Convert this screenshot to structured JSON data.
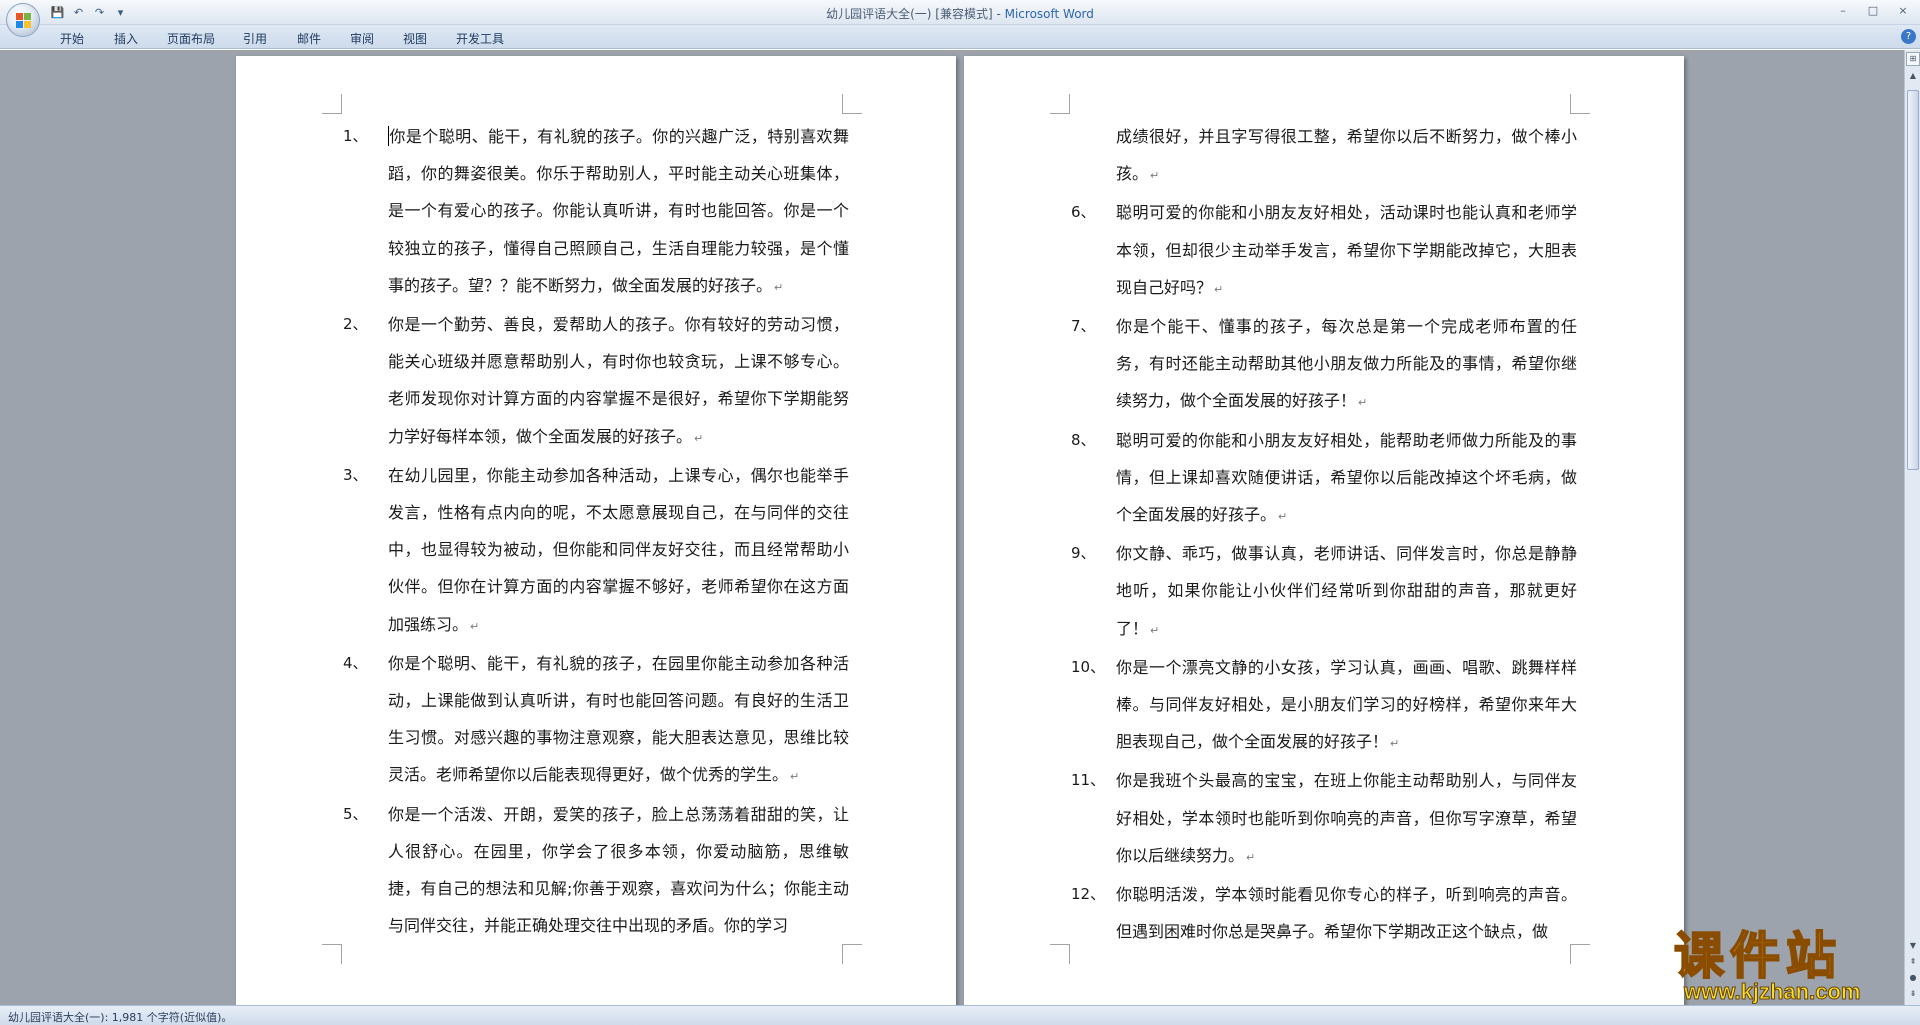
{
  "window": {
    "title": "幼儿园评语大全(一) [兼容模式] - ",
    "app_name": "Microsoft Word",
    "controls": [
      "–",
      "□",
      "×"
    ]
  },
  "quick_access": {
    "icons": [
      "save-icon",
      "undo-icon",
      "redo-icon",
      "customize-icon"
    ],
    "glyphs": [
      "💾",
      "↶",
      "↷",
      "▾"
    ]
  },
  "ribbon": {
    "tabs": [
      "开始",
      "插入",
      "页面布局",
      "引用",
      "邮件",
      "审阅",
      "视图",
      "开发工具"
    ]
  },
  "pages": [
    {
      "items": [
        {
          "num": "1、",
          "text": "你是个聪明、能干，有礼貌的孩子。你的兴趣广泛，特别喜欢舞蹈，你的舞姿很美。你乐于帮助别人，平时能主动关心班集体，是一个有爱心的孩子。你能认真听讲，有时也能回答。你是一个较独立的孩子，懂得自己照顾自己，生活自理能力较强，是个懂事的孩子。望？？能不断努力，做全面发展的好孩子。",
          "mark": true
        },
        {
          "num": "2、",
          "text": "你是一个勤劳、善良，爱帮助人的孩子。你有较好的劳动习惯，能关心班级并愿意帮助别人，有时你也较贪玩，上课不够专心。老师发现你对计算方面的内容掌握不是很好，希望你下学期能努力学好每样本领，做个全面发展的好孩子。",
          "mark": true
        },
        {
          "num": "3、",
          "text": "在幼儿园里，你能主动参加各种活动，上课专心，偶尔也能举手发言，性格有点内向的呢，不太愿意展现自己，在与同伴的交往中，也显得较为被动，但你能和同伴友好交往，而且经常帮助小伙伴。但你在计算方面的内容掌握不够好，老师希望你在这方面加强练习。",
          "mark": true
        },
        {
          "num": "4、",
          "text": "你是个聪明、能干，有礼貌的孩子，在园里你能主动参加各种活动，上课能做到认真听讲，有时也能回答问题。有良好的生活卫生习惯。对感兴趣的事物注意观察，能大胆表达意见，思维比较灵活。老师希望你以后能表现得更好，做个优秀的学生。",
          "mark": true
        },
        {
          "num": "5、",
          "text": "你是一个活泼、开朗，爱笑的孩子，脸上总荡荡着甜甜的笑，让人很舒心。在园里，你学会了很多本领，你爱动脑筋，思维敏捷，有自己的想法和见解;你善于观察，喜欢问为什么；你能主动与同伴交往，并能正确处理交往中出现的矛盾。你的学习",
          "mark": false
        }
      ]
    },
    {
      "items": [
        {
          "num": "",
          "text": "成绩很好，并且字写得很工整，希望你以后不断努力，做个棒小孩。",
          "mark": true
        },
        {
          "num": "6、",
          "text": "聪明可爱的你能和小朋友友好相处，活动课时也能认真和老师学本领，但却很少主动举手发言，希望你下学期能改掉它，大胆表现自己好吗？",
          "mark": true
        },
        {
          "num": "7、",
          "text": "你是个能干、懂事的孩子，每次总是第一个完成老师布置的任务，有时还能主动帮助其他小朋友做力所能及的事情，希望你继续努力，做个全面发展的好孩子！",
          "mark": true
        },
        {
          "num": "8、",
          "text": "聪明可爱的你能和小朋友友好相处，能帮助老师做力所能及的事情，但上课却喜欢随便讲话，希望你以后能改掉这个坏毛病，做个全面发展的好孩子。",
          "mark": true
        },
        {
          "num": "9、",
          "text": "你文静、乖巧，做事认真，老师讲话、同伴发言时，你总是静静地听，如果你能让小伙伴们经常听到你甜甜的声音，那就更好了！",
          "mark": true
        },
        {
          "num": "10、",
          "text": "你是一个漂亮文静的小女孩，学习认真，画画、唱歌、跳舞样样棒。与同伴友好相处，是小朋友们学习的好榜样，希望你来年大胆表现自己，做个全面发展的好孩子！",
          "mark": true
        },
        {
          "num": "11、",
          "text": "你是我班个头最高的宝宝，在班上你能主动帮助别人，与同伴友好相处，学本领时也能听到你响亮的声音，但你写字潦草，希望你以后继续努力。",
          "mark": true
        },
        {
          "num": "12、",
          "text": "你聪明活泼，学本领时能看见你专心的样子，听到响亮的声音。但遇到困难时你总是哭鼻子。希望你下学期改正这个缺点，做",
          "mark": false
        }
      ]
    }
  ],
  "paragraph_mark": "↵",
  "status": {
    "text": "幼儿园评语大全(一): 1,981 个字符(近似值)。"
  },
  "watermark": {
    "title": "课件站",
    "url": "www.kjzhan.com"
  },
  "scrollbar": {
    "ruler_glyph": "⊞",
    "up": "▲",
    "down": "▼",
    "prev_page": "⇞",
    "select_browse": "●",
    "next_page": "⇟"
  },
  "colors": {
    "workspace": "#9da3ac",
    "title_app": "#2d65b3",
    "ribbon_bg": "#dfe8f4",
    "watermark_gold": "#f2b51b"
  }
}
